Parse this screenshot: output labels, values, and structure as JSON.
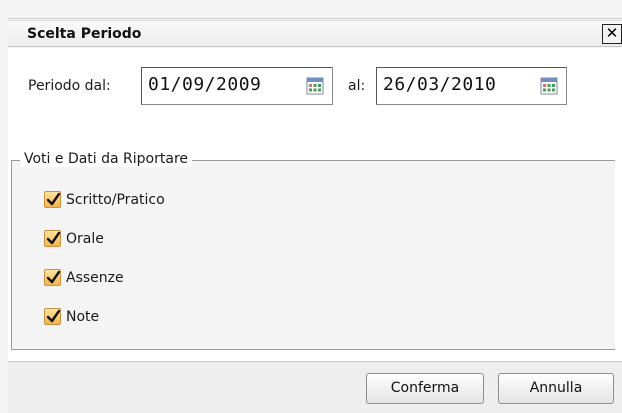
{
  "dialog": {
    "title": "Scelta Periodo",
    "close_label": "✕"
  },
  "period": {
    "from_label": "Periodo dal:",
    "from_value": "01/09/2009",
    "to_label": "al:",
    "to_value": "26/03/2010"
  },
  "group": {
    "legend": "Voti e Dati da Riportare",
    "options": [
      {
        "label": "Scritto/Pratico",
        "checked": true
      },
      {
        "label": "Orale",
        "checked": true
      },
      {
        "label": "Assenze",
        "checked": true
      },
      {
        "label": "Note",
        "checked": true
      }
    ]
  },
  "buttons": {
    "confirm": "Conferma",
    "cancel": "Annulla"
  },
  "colors": {
    "checkbox_fill": "#f3b44a",
    "checkmark": "#111111",
    "calendar_accent": "#4a9a5a"
  },
  "icons": {
    "calendar": "calendar-icon",
    "close": "close-icon",
    "check": "checkmark-icon"
  }
}
